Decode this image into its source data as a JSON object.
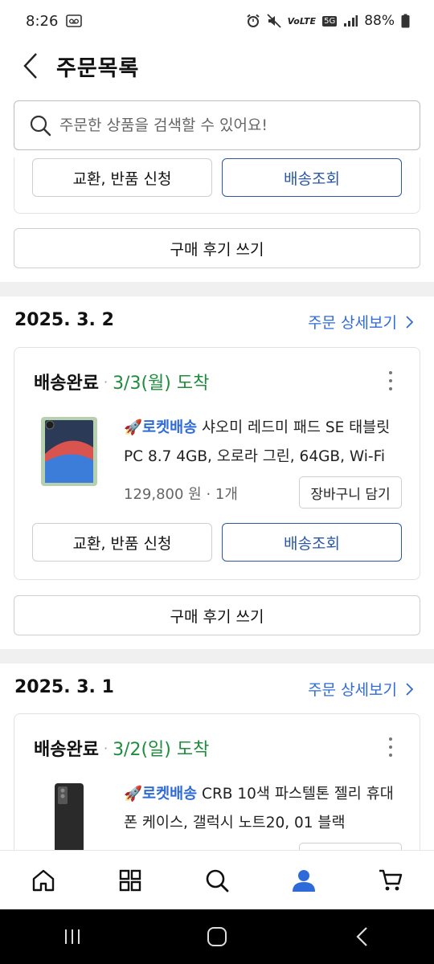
{
  "status_bar": {
    "time": "8:26",
    "battery": "88%",
    "network": "5G"
  },
  "header": {
    "title": "주문목록"
  },
  "search": {
    "placeholder": "주문한 상품을 검색할 수 있어요!"
  },
  "partial_order": {
    "exchange_label": "교환, 반품 신청",
    "track_label": "배송조회",
    "review_label": "구매 후기 쓰기"
  },
  "orders": [
    {
      "date": "2025. 3. 2",
      "detail_link": "주문 상세보기",
      "status": "배송완료",
      "arrival": "3/3(월) 도착",
      "badge": "로켓배송",
      "product": "샤오미 레드미 패드 SE 태블릿 PC 8.7 4GB, 오로라 그린, 64GB, Wi-Fi",
      "price_qty": "129,800 원 · 1개",
      "cart_label": "장바구니 담기",
      "exchange_label": "교환, 반품 신청",
      "track_label": "배송조회",
      "review_label": "구매 후기 쓰기"
    },
    {
      "date": "2025. 3. 1",
      "detail_link": "주문 상세보기",
      "status": "배송완료",
      "arrival": "3/2(일) 도착",
      "badge": "로켓배송",
      "product": "CRB 10색 파스텔톤 젤리 휴대폰 케이스, 갤럭시 노트20, 01 블랙"
    }
  ],
  "colors": {
    "accent_blue": "#2f6bd8",
    "button_blue": "#2b57a8",
    "arrival_green": "#1e8c3c"
  },
  "bottom_nav": [
    "home-icon",
    "category-grid-icon",
    "search-icon",
    "my-page-icon",
    "cart-icon"
  ],
  "system_nav": [
    "recent-apps-icon",
    "home-button-icon",
    "back-icon"
  ]
}
